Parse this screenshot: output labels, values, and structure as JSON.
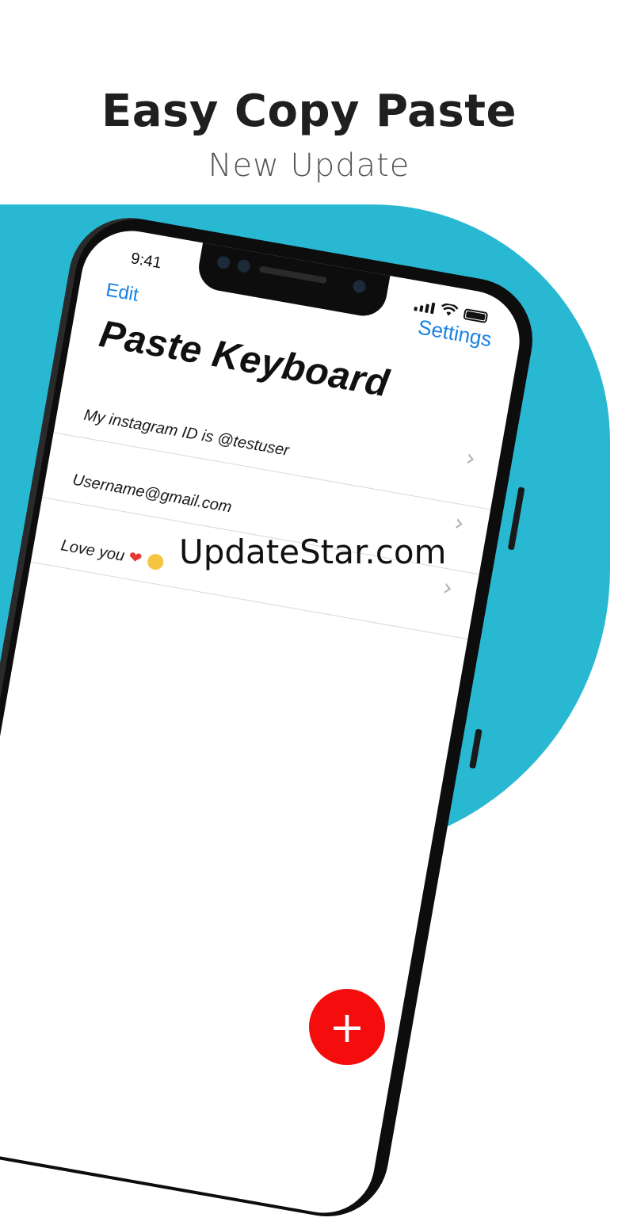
{
  "hero": {
    "title": "Easy Copy Paste",
    "subtitle": "New Update"
  },
  "colors": {
    "accent_teal": "#29b8d2",
    "link_blue": "#1a82e2",
    "fab_red": "#f50c0c"
  },
  "status_bar": {
    "time": "9:41",
    "icons": [
      "signal-icon",
      "wifi-icon",
      "battery-icon"
    ]
  },
  "nav": {
    "edit_label": "Edit",
    "settings_label": "Settings"
  },
  "page": {
    "title": "Paste Keyboard"
  },
  "list": {
    "items": [
      {
        "text": "My instagram ID is @testuser"
      },
      {
        "text": "Username@gmail.com"
      },
      {
        "text": "Love you"
      }
    ],
    "chevron_glyph": "›"
  },
  "fab": {
    "label": "+"
  },
  "watermark": "UpdateStar.com"
}
